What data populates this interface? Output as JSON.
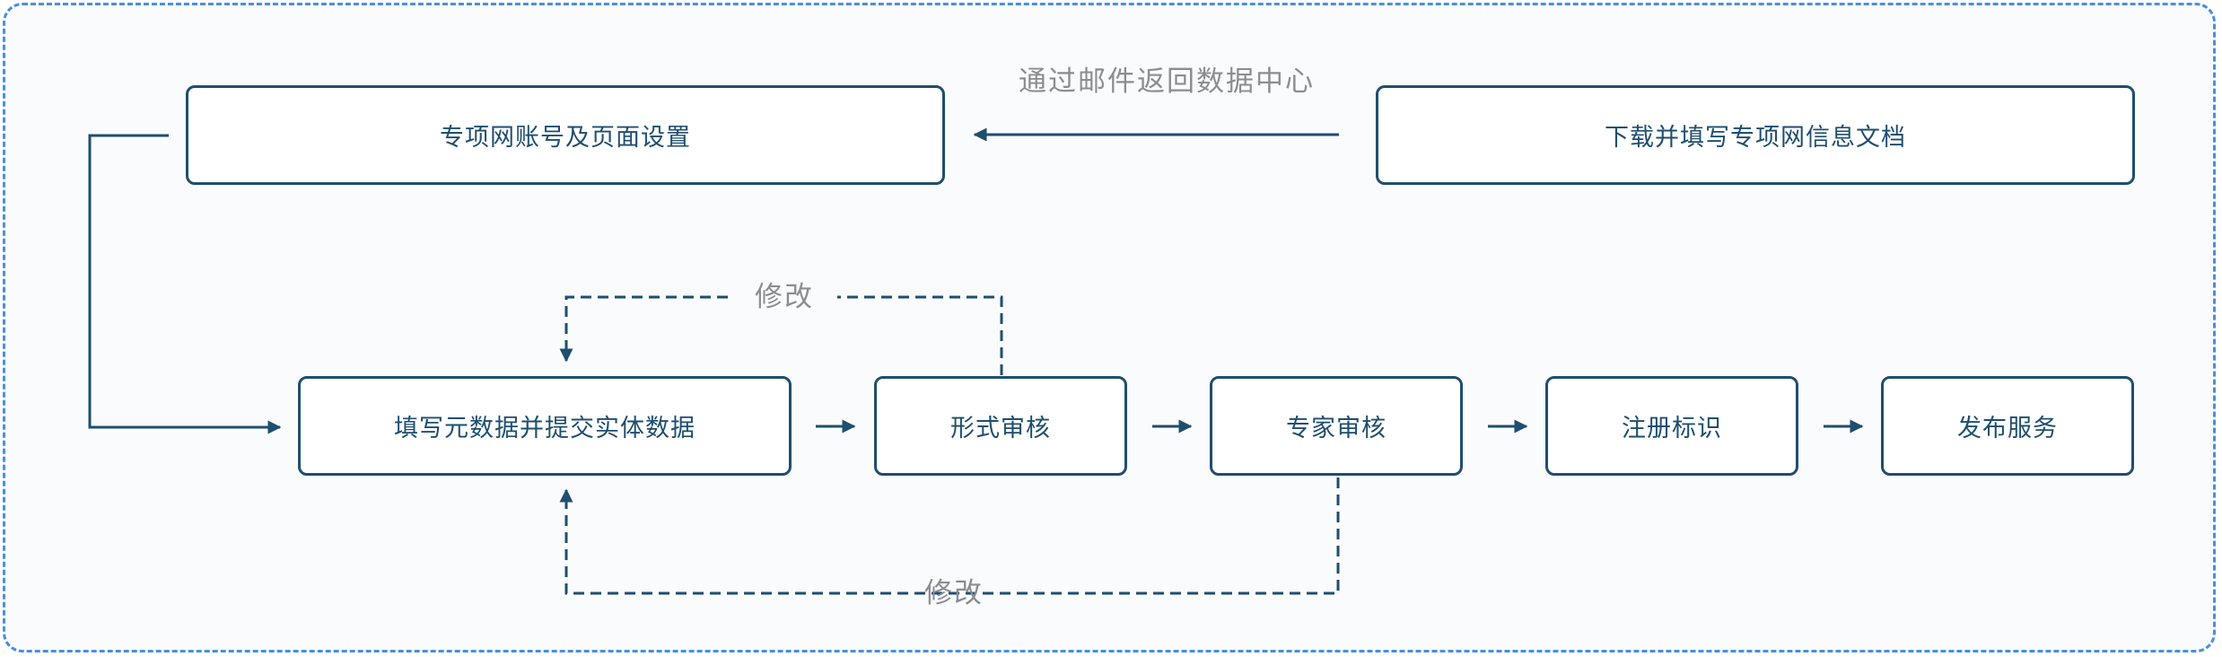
{
  "nodes": {
    "account_setup": "专项网账号及页面设置",
    "download_doc": "下载并填写专项网信息文档",
    "fill_metadata": "填写元数据并提交实体数据",
    "format_review": "形式审核",
    "expert_review": "专家审核",
    "register_id": "注册标识",
    "publish_service": "发布服务"
  },
  "edge_labels": {
    "email_return": "通过邮件返回数据中心",
    "revise_top": "修改",
    "revise_bottom": "修改"
  },
  "colors": {
    "frame_border": "#4a8fdc",
    "node_border": "#1f4e6e",
    "text": "#1f4e6e",
    "label_text": "#8a8d91"
  }
}
